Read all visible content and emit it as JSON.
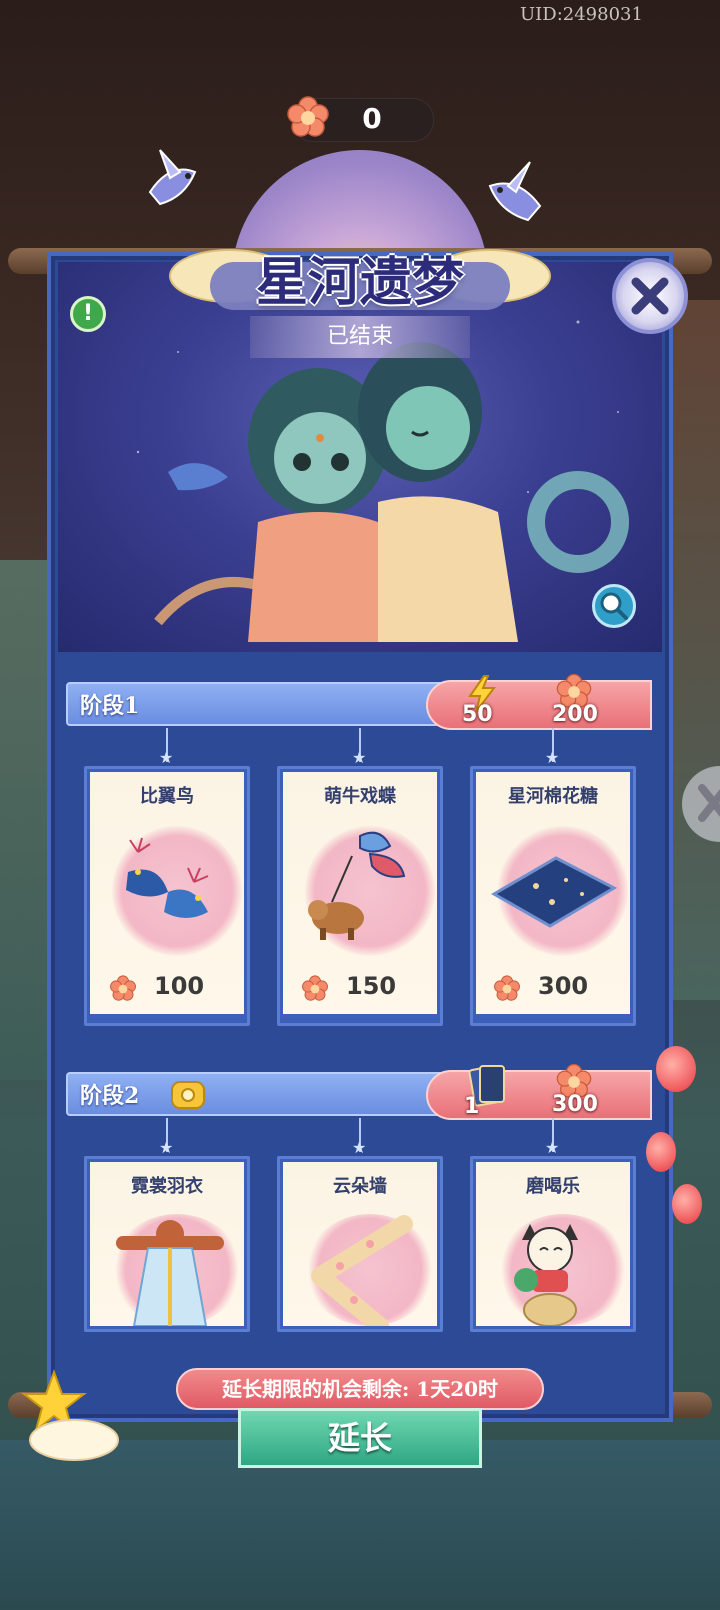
{
  "header": {
    "uid": "UID:2498031",
    "currency_value": "0"
  },
  "event": {
    "title": "星河遗梦",
    "status": "已结束"
  },
  "stages": [
    {
      "label": "阶段1",
      "costs": [
        {
          "icon": "lightning-icon",
          "value": "50"
        },
        {
          "icon": "flower-coin-icon",
          "value": "200"
        }
      ],
      "items": [
        {
          "name": "比翼鸟",
          "price": "100"
        },
        {
          "name": "萌牛戏蝶",
          "price": "150"
        },
        {
          "name": "星河棉花糖",
          "price": "300"
        }
      ]
    },
    {
      "label": "阶段2",
      "costs": [
        {
          "icon": "ticket-icon",
          "value": "1"
        },
        {
          "icon": "flower-coin-icon",
          "value": "300"
        }
      ],
      "items": [
        {
          "name": "霓裳羽衣"
        },
        {
          "name": "云朵墙"
        },
        {
          "name": "磨喝乐"
        }
      ]
    }
  ],
  "footer": {
    "extend_note": "延长期限的机会剩余: 1天20时",
    "extend_button": "延长"
  },
  "colors": {
    "panel": "#2d4a96",
    "accent_pink": "#e97078",
    "button_green": "#2fa684"
  }
}
